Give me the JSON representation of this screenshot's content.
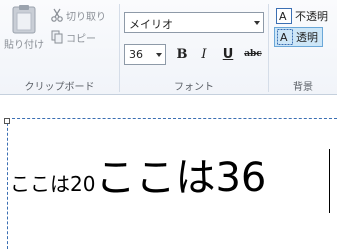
{
  "ribbon": {
    "clipboard": {
      "paste_label": "貼り付け",
      "cut_label": "切り取り",
      "copy_label": "コピー",
      "group_label": "クリップボード"
    },
    "font": {
      "family_value": "メイリオ",
      "size_value": "36",
      "bold_label": "B",
      "italic_label": "I",
      "underline_label": "U",
      "strike_label": "abc",
      "group_label": "フォント"
    },
    "background": {
      "opaque_label": "不透明",
      "transparent_label": "透明",
      "selected": "transparent",
      "group_label": "背景"
    }
  },
  "canvas": {
    "text_small": "ここは20",
    "text_large": "ここは36"
  },
  "colors": {
    "selection_blue": "#cde6f7",
    "dashed_border": "#3b6fb3"
  }
}
